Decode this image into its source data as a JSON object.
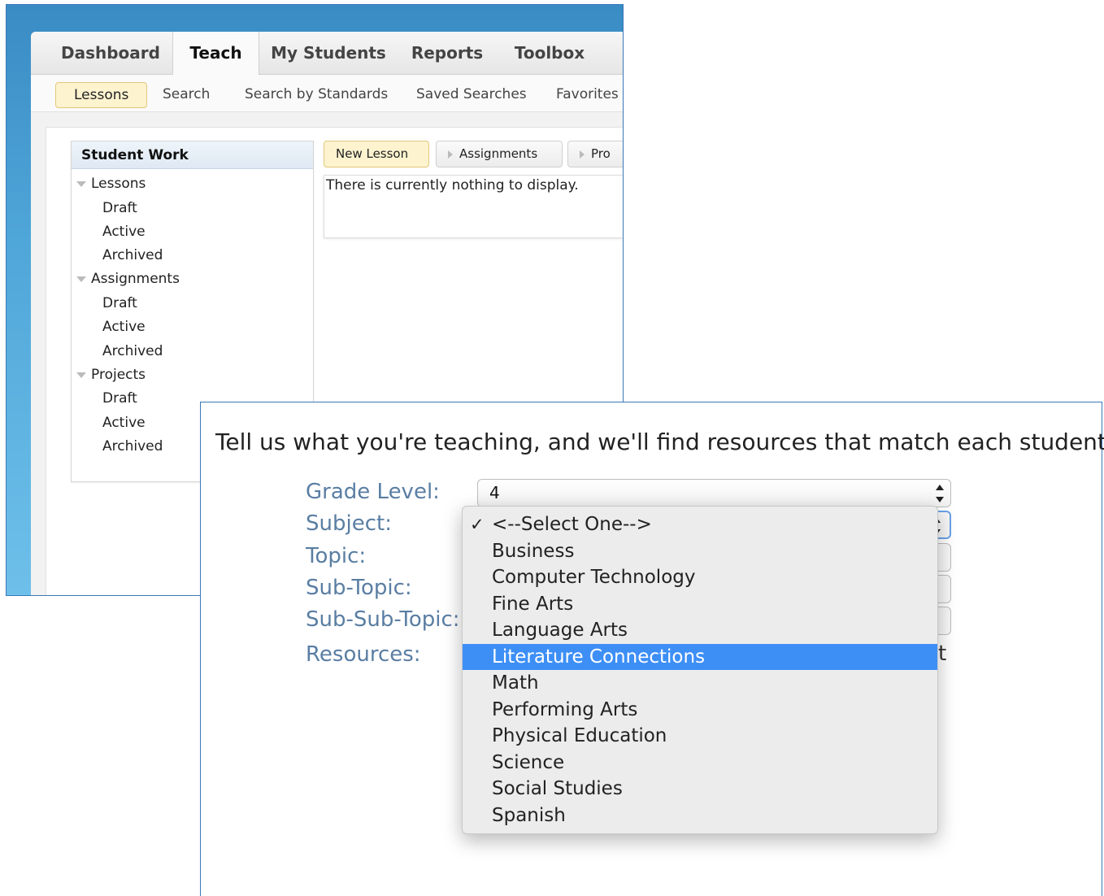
{
  "app": {
    "tabs": [
      "Dashboard",
      "Teach",
      "My Students",
      "Reports",
      "Toolbox"
    ],
    "active_tab": "Teach",
    "subtabs": [
      "Lessons",
      "Search",
      "Search by Standards",
      "Saved Searches",
      "Favorites"
    ],
    "active_subtab": "Lessons"
  },
  "sidebar": {
    "title": "Student Work",
    "groups": [
      {
        "label": "Lessons",
        "items": [
          "Draft",
          "Active",
          "Archived"
        ]
      },
      {
        "label": "Assignments",
        "items": [
          "Draft",
          "Active",
          "Archived"
        ]
      },
      {
        "label": "Projects",
        "items": [
          "Draft",
          "Active",
          "Archived"
        ]
      }
    ]
  },
  "toolbar": {
    "new_lesson": "New Lesson",
    "assignments": "Assignments",
    "projects_truncated": "Pro"
  },
  "empty_message": "There is currently nothing to display.",
  "finder": {
    "intro": "Tell us what you're teaching, and we'll find resources that match each student.",
    "labels": {
      "grade": "Grade Level:",
      "subject": "Subject:",
      "topic": "Topic:",
      "subtopic": "Sub-Topic:",
      "subsubtopic": "Sub-Sub-Topic:",
      "resources": "Resources:"
    },
    "grade_value": "4",
    "resources_trailing": "t",
    "subject_options": [
      "<--Select One-->",
      "Business",
      "Computer Technology",
      "Fine Arts",
      "Language Arts",
      "Literature Connections",
      "Math",
      "Performing Arts",
      "Physical Education",
      "Science",
      "Social Studies",
      "Spanish"
    ],
    "checked_option": "<--Select One-->",
    "highlighted_option": "Literature Connections"
  },
  "colors": {
    "highlight": "#3d8ff6",
    "label_blue": "#5a7ea3",
    "frame_border": "#3a78b8"
  }
}
